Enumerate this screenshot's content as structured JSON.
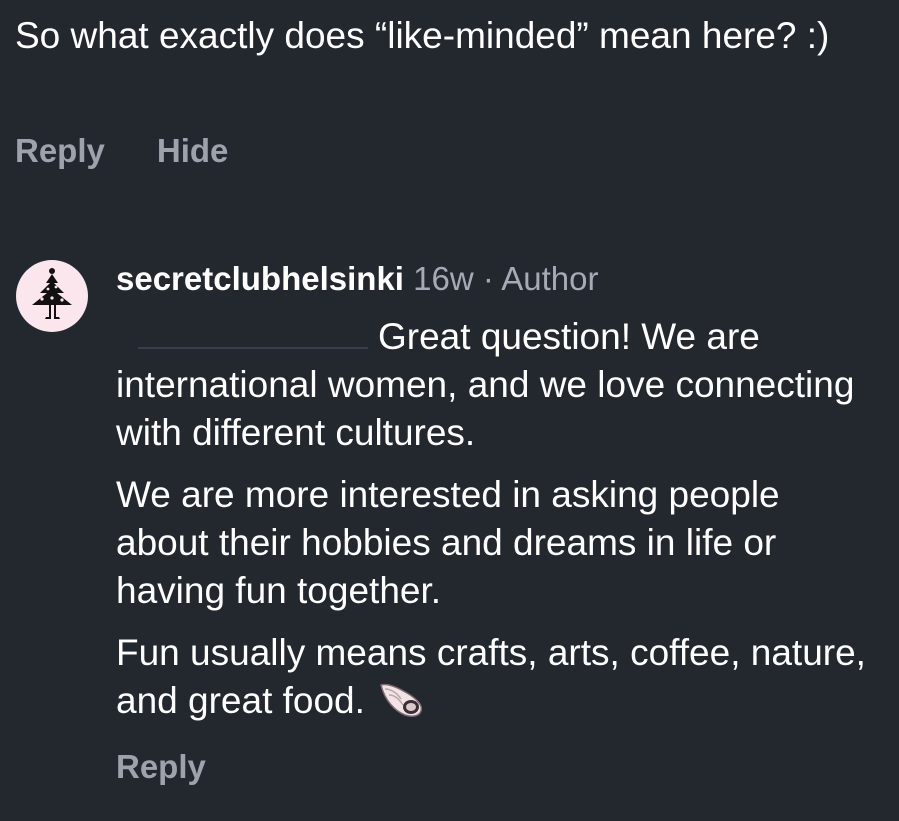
{
  "parent_comment": {
    "text": "So what exactly does “like-minded” mean here? :)",
    "actions": {
      "reply_label": "Reply",
      "hide_label": "Hide"
    }
  },
  "reply": {
    "username": "secretclubhelsinki",
    "age": "16w",
    "separator": "·",
    "role": "Author",
    "paragraphs": [
      "Great question! We are international women, and we love connecting with different cultures.",
      "We are more interested in asking people about their hobbies and dreams in life or having fun together.",
      "Fun usually means crafts, arts, coffee, nature, and great food."
    ],
    "reply_label": "Reply"
  },
  "colors": {
    "background": "#23272e",
    "text": "#ffffff",
    "muted": "#9ea3ab",
    "avatar_bg": "#fbe6ee"
  },
  "icons": {
    "avatar": "tree-figure-logo",
    "emoji": "spiral-shell-icon"
  }
}
